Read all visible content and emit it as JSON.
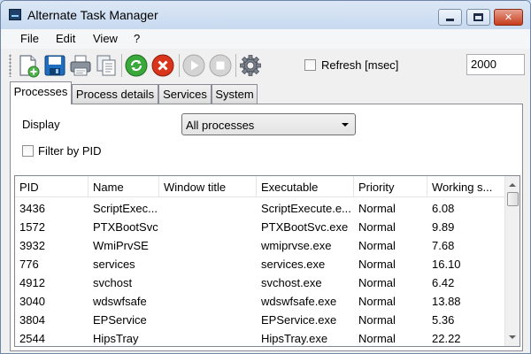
{
  "window": {
    "title": "Alternate Task Manager"
  },
  "menu": [
    "File",
    "Edit",
    "View",
    "?"
  ],
  "toolbar": {
    "icons": [
      "new-document-icon",
      "save-icon",
      "print-icon",
      "copy-icon",
      "refresh-icon",
      "stop-process-icon",
      "play-icon",
      "pause-icon",
      "settings-gear-icon"
    ],
    "refresh_label": "Refresh [msec]",
    "refresh_checked": false,
    "refresh_value": "2000"
  },
  "tabs": [
    "Processes",
    "Process details",
    "Services",
    "System"
  ],
  "active_tab": "Processes",
  "filters": {
    "display_label": "Display",
    "display_value": "All processes",
    "filter_label": "Filter by PID",
    "filter_checked": false
  },
  "table": {
    "columns": [
      "PID",
      "Name",
      "Window title",
      "Executable",
      "Priority",
      "Working s..."
    ],
    "rows": [
      [
        "3436",
        "ScriptExec...",
        "",
        "ScriptExecute.e...",
        "Normal",
        "6.08"
      ],
      [
        "1572",
        "PTXBootSvc",
        "",
        "PTXBootSvc.exe",
        "Normal",
        "9.89"
      ],
      [
        "3932",
        "WmiPrvSE",
        "",
        "wmiprvse.exe",
        "Normal",
        "7.68"
      ],
      [
        "776",
        "services",
        "",
        "services.exe",
        "Normal",
        "16.10"
      ],
      [
        "4912",
        "svchost",
        "",
        "svchost.exe",
        "Normal",
        "6.42"
      ],
      [
        "3040",
        "wdswfsafe",
        "",
        "wdswfsafe.exe",
        "Normal",
        "13.88"
      ],
      [
        "3804",
        "EPService",
        "",
        "EPService.exe",
        "Normal",
        "5.36"
      ],
      [
        "2544",
        "HipsTray",
        "",
        "HipsTray.exe",
        "Normal",
        "22.22"
      ]
    ]
  },
  "colors": {
    "titlebar": "#c8daf0",
    "close_button": "#c73c1c",
    "refresh_icon": "#3aa83a",
    "stop_icon": "#d9341c"
  }
}
